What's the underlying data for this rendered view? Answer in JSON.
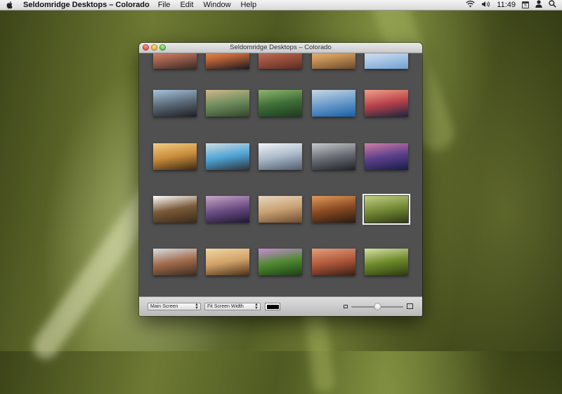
{
  "menubar": {
    "app_name": "Seldomridge Desktops – Colorado",
    "menus": [
      "File",
      "Edit",
      "Window",
      "Help"
    ],
    "volume_value": "40",
    "clock": "11:49",
    "calendar_day": "5"
  },
  "window": {
    "title": "Seldomridge Desktops – Colorado"
  },
  "gallery": {
    "selected_index": 19,
    "thumbnails": [
      {
        "name": "red-rocks",
        "colors": [
          "#3a2a25",
          "#b06a55",
          "#d9b29a"
        ]
      },
      {
        "name": "sunset-ridge",
        "colors": [
          "#1d1a1e",
          "#c7693b",
          "#f1c079"
        ]
      },
      {
        "name": "red-canyon",
        "colors": [
          "#5c2c22",
          "#a85a44",
          "#cfa08a"
        ]
      },
      {
        "name": "sand-dunes",
        "colors": [
          "#6b4a2b",
          "#d19a5c",
          "#efd3a3"
        ]
      },
      {
        "name": "blue-sky",
        "colors": [
          "#6f9fd1",
          "#b9d1ea",
          "#eef3f7"
        ]
      },
      {
        "name": "rock-cliff-sky",
        "colors": [
          "#1e1f22",
          "#5b6a78",
          "#a8c4dc"
        ]
      },
      {
        "name": "mountain-lake",
        "colors": [
          "#31472a",
          "#6f8c5d",
          "#d1b88a"
        ]
      },
      {
        "name": "green-forest",
        "colors": [
          "#1d3a1f",
          "#3f6e36",
          "#8fb56d"
        ]
      },
      {
        "name": "blue-mountain-range",
        "colors": [
          "#1a5fa6",
          "#6b9ccb",
          "#c9d7e2"
        ]
      },
      {
        "name": "red-sunset-clouds",
        "colors": [
          "#1b2540",
          "#b8424a",
          "#f2a08a"
        ]
      },
      {
        "name": "golden-haze",
        "colors": [
          "#3c2814",
          "#c78a3a",
          "#f3cd84"
        ]
      },
      {
        "name": "blue-ice-clouds",
        "colors": [
          "#2e3238",
          "#4da4d6",
          "#d0dbe2"
        ]
      },
      {
        "name": "snowy-peaks",
        "colors": [
          "#4e5c6f",
          "#a9b8c8",
          "#f0f4f7"
        ]
      },
      {
        "name": "lone-tree-night",
        "colors": [
          "#1f2228",
          "#6a6e74",
          "#c6c9cc"
        ]
      },
      {
        "name": "purple-dusk",
        "colors": [
          "#1a1d46",
          "#5b3f8c",
          "#d07da2"
        ]
      },
      {
        "name": "white-daisy",
        "colors": [
          "#3a2a1a",
          "#7a5a38",
          "#ffffff"
        ]
      },
      {
        "name": "purple-dusk-hills",
        "colors": [
          "#1e1732",
          "#6d4f86",
          "#c9a8c6"
        ]
      },
      {
        "name": "desert-scrub",
        "colors": [
          "#6c4b2e",
          "#c9a274",
          "#e7d6bf"
        ]
      },
      {
        "name": "sand-streak",
        "colors": [
          "#2a1a12",
          "#8b4a22",
          "#e19a5a"
        ]
      },
      {
        "name": "green-grass-blade",
        "colors": [
          "#2f3a14",
          "#748a35",
          "#c3d088"
        ]
      },
      {
        "name": "cloudy-mesa",
        "colors": [
          "#3b2c22",
          "#a26b4b",
          "#d6dde3"
        ]
      },
      {
        "name": "golden-dunes",
        "colors": [
          "#4a3018",
          "#d0a268",
          "#f2d6a4"
        ]
      },
      {
        "name": "purple-flower",
        "colors": [
          "#1f3f16",
          "#4f8a30",
          "#c98ad9"
        ]
      },
      {
        "name": "red-canyon-walls",
        "colors": [
          "#3a1f15",
          "#b0583a",
          "#e3a07b"
        ]
      },
      {
        "name": "dew-on-grass",
        "colors": [
          "#2e3b12",
          "#6d8a2a",
          "#d8e0a8"
        ]
      }
    ]
  },
  "toolbar": {
    "screen_popup": "Main Screen",
    "fit_popup": "Fit Screen Width",
    "background_color": "#000000",
    "zoom_level": 0.5
  }
}
